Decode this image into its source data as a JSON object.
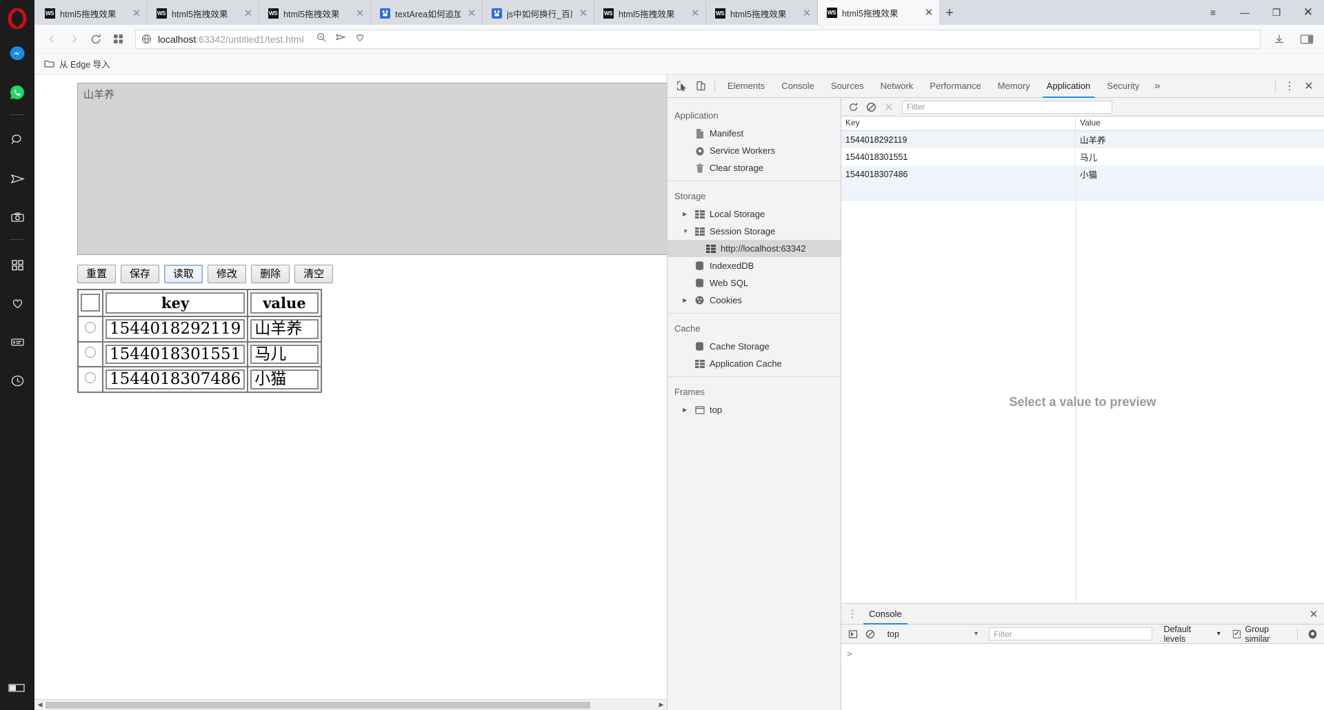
{
  "browser": {
    "tabs": [
      {
        "title": "html5拖拽效果",
        "favicon": "webstorm-icon",
        "active": false
      },
      {
        "title": "html5拖拽效果",
        "favicon": "webstorm-icon",
        "active": false
      },
      {
        "title": "html5拖拽效果",
        "favicon": "webstorm-icon",
        "active": false
      },
      {
        "title": "textArea如何追加",
        "favicon": "baidu-icon",
        "active": false
      },
      {
        "title": "js中如何换行_百度",
        "favicon": "baidu-icon",
        "active": false
      },
      {
        "title": "html5拖拽效果",
        "favicon": "webstorm-icon",
        "active": false
      },
      {
        "title": "html5拖拽效果",
        "favicon": "webstorm-icon",
        "active": false
      },
      {
        "title": "html5拖拽效果",
        "favicon": "webstorm-icon",
        "active": true
      }
    ],
    "new_tab_label": "+",
    "window_controls": {
      "menu": "≡",
      "minimize": "—",
      "maximize": "❐",
      "close": "✕"
    },
    "nav": {
      "back": "back-arrow",
      "forward": "forward-arrow",
      "reload": "reload-arrow",
      "speeddial": "speed-dial-grid"
    },
    "omnibox": {
      "scheme_icon": "globe-icon",
      "host": "localhost",
      "path": ":63342/untitled1/test.html",
      "zoom_icon": "search-zoom-icon",
      "share_icon": "send-icon",
      "heart_icon": "heart-icon"
    },
    "toolbar_right": {
      "download": "download-icon",
      "sidebar": "sidebar-toggle-icon"
    },
    "bookmarks": {
      "folder_icon": "folder-icon",
      "label": "从 Edge 导入"
    }
  },
  "rail": {
    "logo": "opera-logo",
    "items": [
      {
        "name": "messenger-icon"
      },
      {
        "name": "whatsapp-icon"
      },
      {
        "name": "separator"
      },
      {
        "name": "search-icon"
      },
      {
        "name": "send-icon"
      },
      {
        "name": "snapshot-icon"
      },
      {
        "name": "separator"
      },
      {
        "name": "workspaces-icon"
      },
      {
        "name": "heart-icon"
      },
      {
        "name": "news-icon"
      },
      {
        "name": "history-icon"
      }
    ],
    "bottom": {
      "name": "player-icon"
    }
  },
  "page": {
    "textarea_value": "山羊养",
    "buttons": [
      {
        "label": "重置",
        "focused": false
      },
      {
        "label": "保存",
        "focused": false
      },
      {
        "label": "读取",
        "focused": true
      },
      {
        "label": "修改",
        "focused": false
      },
      {
        "label": "删除",
        "focused": false
      },
      {
        "label": "清空",
        "focused": false
      }
    ],
    "table": {
      "headers": [
        "",
        "key",
        "value"
      ],
      "rows": [
        {
          "selected": false,
          "key": "1544018292119",
          "value": "山羊养"
        },
        {
          "selected": false,
          "key": "1544018301551",
          "value": "马儿"
        },
        {
          "selected": false,
          "key": "1544018307486",
          "value": "小猫"
        }
      ]
    },
    "scrollbar": {
      "left_arrow": "◀",
      "right_arrow": "▶"
    }
  },
  "devtools": {
    "toolbar_icons": {
      "inspect": "inspect-element-icon",
      "device": "device-toolbar-icon"
    },
    "tabs": [
      {
        "label": "Elements",
        "active": false
      },
      {
        "label": "Console",
        "active": false
      },
      {
        "label": "Sources",
        "active": false
      },
      {
        "label": "Network",
        "active": false
      },
      {
        "label": "Performance",
        "active": false
      },
      {
        "label": "Memory",
        "active": false
      },
      {
        "label": "Application",
        "active": true
      },
      {
        "label": "Security",
        "active": false
      }
    ],
    "overflow_label": "»",
    "kebab_label": "⋮",
    "close_label": "✕",
    "sidebar": {
      "groups": [
        {
          "title": "Application",
          "items": [
            {
              "label": "Manifest",
              "icon": "manifest-file-icon",
              "level": 1,
              "arrow": "none",
              "selected": false
            },
            {
              "label": "Service Workers",
              "icon": "gear-icon",
              "level": 1,
              "arrow": "none",
              "selected": false
            },
            {
              "label": "Clear storage",
              "icon": "trash-icon",
              "level": 1,
              "arrow": "none",
              "selected": false
            }
          ]
        },
        {
          "title": "Storage",
          "items": [
            {
              "label": "Local Storage",
              "icon": "table-grid-icon",
              "level": 1,
              "arrow": "collapsed",
              "selected": false
            },
            {
              "label": "Session Storage",
              "icon": "table-grid-icon",
              "level": 1,
              "arrow": "expanded",
              "selected": false
            },
            {
              "label": "http://localhost:63342",
              "icon": "table-grid-icon",
              "level": 2,
              "arrow": "none",
              "selected": true
            },
            {
              "label": "IndexedDB",
              "icon": "database-icon",
              "level": 1,
              "arrow": "none",
              "selected": false
            },
            {
              "label": "Web SQL",
              "icon": "database-icon",
              "level": 1,
              "arrow": "none",
              "selected": false
            },
            {
              "label": "Cookies",
              "icon": "cookie-icon",
              "level": 1,
              "arrow": "collapsed",
              "selected": false
            }
          ]
        },
        {
          "title": "Cache",
          "items": [
            {
              "label": "Cache Storage",
              "icon": "database-icon",
              "level": 1,
              "arrow": "none",
              "selected": false
            },
            {
              "label": "Application Cache",
              "icon": "table-grid-icon",
              "level": 1,
              "arrow": "none",
              "selected": false
            }
          ]
        },
        {
          "title": "Frames",
          "items": [
            {
              "label": "top",
              "icon": "frame-icon",
              "level": 1,
              "arrow": "collapsed",
              "selected": false
            }
          ]
        }
      ]
    },
    "storage_toolbar": {
      "refresh_icon": "refresh-icon",
      "clear_icon": "clear-all-icon",
      "delete_icon": "delete-selected-icon",
      "filter_placeholder": "Filter"
    },
    "storage_table": {
      "columns": [
        "Key",
        "Value"
      ],
      "rows": [
        {
          "key": "1544018292119",
          "value": "山羊养"
        },
        {
          "key": "1544018301551",
          "value": "马儿"
        },
        {
          "key": "1544018307486",
          "value": "小猫"
        }
      ]
    },
    "preview_placeholder": "Select a value to preview",
    "console_drawer": {
      "kebab": "⋮",
      "tab_label": "Console",
      "close_label": "✕",
      "execute_icon": "execution-context-icon",
      "clear_icon": "clear-console-icon",
      "context_value": "top",
      "context_caret": "▾",
      "filter_placeholder": "Filter",
      "levels_label": "Default levels",
      "levels_caret": "▾",
      "group_similar_label": "Group similar",
      "group_similar_checked": true,
      "settings_icon": "gear-icon",
      "prompt": ">"
    }
  }
}
